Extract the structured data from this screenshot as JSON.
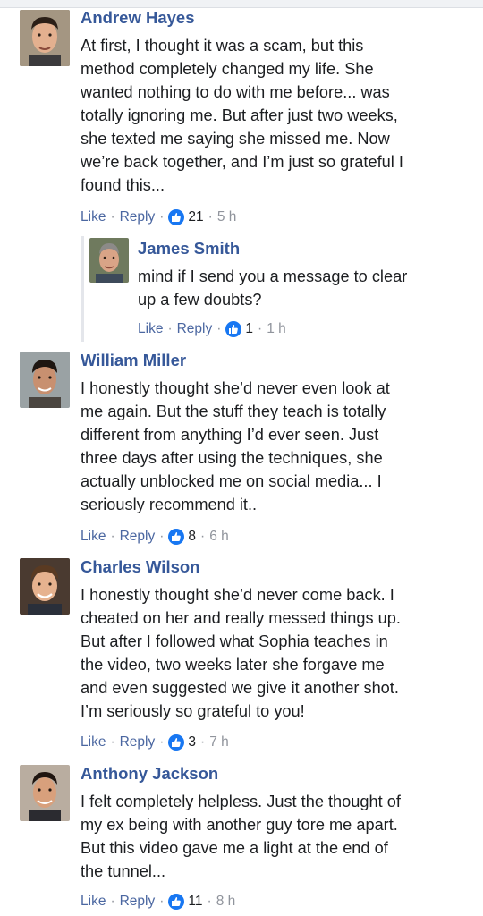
{
  "comments": [
    {
      "name": "Andrew Hayes",
      "lines": [
        "At first, I thought it was a scam, but this",
        "method completely changed my life. She",
        "wanted nothing to do with me before... was",
        "totally ignoring me. But after just two weeks,",
        "she texted me saying she missed me. Now",
        "we’re back together, and I’m just so grateful I",
        "found this..."
      ],
      "like": "Like",
      "reply": "Reply",
      "count": "21",
      "time": "5 h"
    },
    {
      "name": "James Smith",
      "lines": [
        "mind if I send you a message to clear",
        "up a few doubts?"
      ],
      "like": "Like",
      "reply": "Reply",
      "count": "1",
      "time": "1 h"
    },
    {
      "name": "William Miller",
      "lines": [
        "I honestly thought she’d never even look at",
        "me again. But the stuff they teach is totally",
        "different from anything I’d ever seen. Just",
        "three days after using the techniques, she",
        "actually unblocked me on social media... I",
        "seriously recommend it.."
      ],
      "like": "Like",
      "reply": "Reply",
      "count": "8",
      "time": "6 h"
    },
    {
      "name": "Charles Wilson",
      "lines": [
        "I honestly thought she’d never come back. I",
        "cheated on her and really messed things up.",
        "But after I followed what Sophia teaches in",
        "the video, two weeks later she forgave me",
        "and even suggested we give it another shot.",
        "I’m seriously so grateful to you!"
      ],
      "like": "Like",
      "reply": "Reply",
      "count": "3",
      "time": "7 h"
    },
    {
      "name": "Anthony Jackson",
      "lines": [
        "I felt completely helpless. Just the thought of",
        "my ex being with another guy tore me apart.",
        "But this video gave me a light at the end of",
        "the tunnel..."
      ],
      "like": "Like",
      "reply": "Reply",
      "count": "11",
      "time": "8 h"
    }
  ],
  "colors": {
    "name": "#365899",
    "link": "#4b67a1",
    "meta": "#90949c",
    "like_badge": "#1877f2"
  },
  "icons": {
    "avatar": "avatar-photo",
    "like": "thumbs-up-icon"
  }
}
